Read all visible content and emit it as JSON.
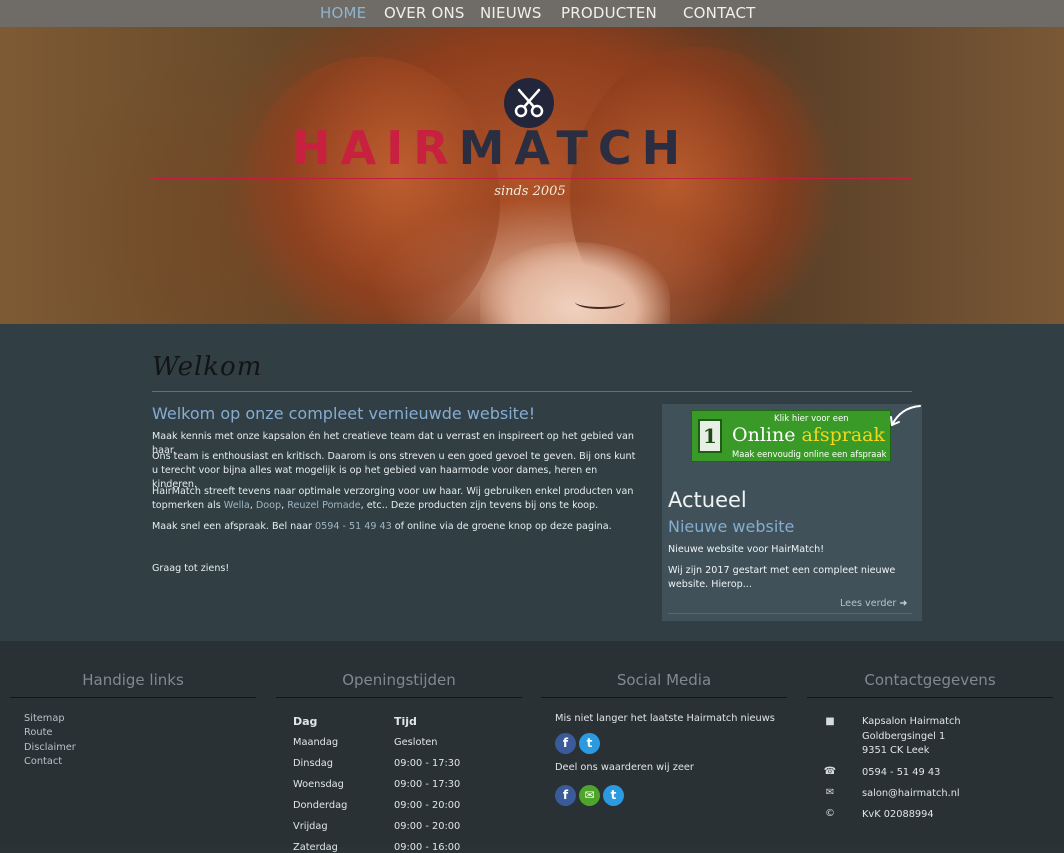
{
  "nav": {
    "items": [
      {
        "label": "HOME",
        "active": true
      },
      {
        "label": "OVER ONS"
      },
      {
        "label": "NIEUWS"
      },
      {
        "label": "PRODUCTEN"
      },
      {
        "label": "CONTACT"
      }
    ]
  },
  "hero": {
    "logo_hair": "HAIR",
    "logo_match": "MATCH",
    "tagline": "sinds 2005",
    "logo_icon": "scissors-icon"
  },
  "welcome": {
    "title": "Welkom",
    "heading": "Welkom op onze compleet vernieuwde website!",
    "p1": "Maak kennis met onze kapsalon én het creatieve team dat u verrast en inspireert op het gebied van haar.",
    "p2": "Ons team is enthousiast en kritisch. Daarom is ons streven u een goed gevoel te geven. Bij ons kunt u terecht voor bijna alles wat mogelijk is op het gebied van haarmode voor dames, heren en kinderen.",
    "p3_a": "HairMatch streeft tevens naar optimale verzorging voor uw haar. Wij gebruiken enkel producten van topmerken als ",
    "brand_wella": "Wella",
    "sep1": ", ",
    "brand_doop": "Doop",
    "sep2": ", ",
    "brand_reuzel": "Reuzel Pomade",
    "p3_b": ", etc.. Deze producten zijn tevens bij ons te koop.",
    "p4_a": "Maak snel een afspraak. Bel naar ",
    "phone": "0594 - 51 49 43",
    "p4_b": " of online via de groene knop op deze pagina.",
    "p5": "Graag tot ziens!"
  },
  "sidebar": {
    "badge_day": "1",
    "badge_top": "Klik hier voor een",
    "badge_main_a": "Online ",
    "badge_main_b": "afspraak",
    "badge_sub": "Maak eenvoudig online een afspraak",
    "actueel": "Actueel",
    "news_title": "Nieuwe website",
    "news_p1": "Nieuwe website voor HairMatch!",
    "news_p2": "Wij zijn 2017 gestart met een compleet nieuwe website. Hierop...",
    "read_more": "Lees verder"
  },
  "footer": {
    "links_title": "Handige links",
    "links": [
      "Sitemap",
      "Route",
      "Disclaimer",
      "Contact"
    ],
    "hours_title": "Openingstijden",
    "hours_head_day": "Dag",
    "hours_head_time": "Tijd",
    "hours": [
      {
        "day": "Maandag",
        "time": "Gesloten"
      },
      {
        "day": "Dinsdag",
        "time": "09:00 - 17:30"
      },
      {
        "day": "Woensdag",
        "time": "09:00 - 17:30"
      },
      {
        "day": "Donderdag",
        "time": "09:00 - 20:00"
      },
      {
        "day": "Vrijdag",
        "time": "09:00 - 20:00"
      },
      {
        "day": "Zaterdag",
        "time": "09:00 - 16:00"
      }
    ],
    "social_title": "Social Media",
    "social_text1": "Mis niet langer het laatste Hairmatch nieuws",
    "social_text2": "Deel ons waarderen wij zeer",
    "contact_title": "Contactgegevens",
    "company": "Kapsalon Hairmatch",
    "street": "Goldbergsingel 1",
    "city": "9351 CK Leek",
    "phone": "0594 - 51 49 43",
    "email": "salon@hairmatch.nl",
    "kvk": "KvK 02088994"
  },
  "colors": {
    "nav_active": "#8fb4cf",
    "accent_red": "#c8203f",
    "heading_blue": "#86acd0",
    "badge_green": "#3a9a28"
  }
}
